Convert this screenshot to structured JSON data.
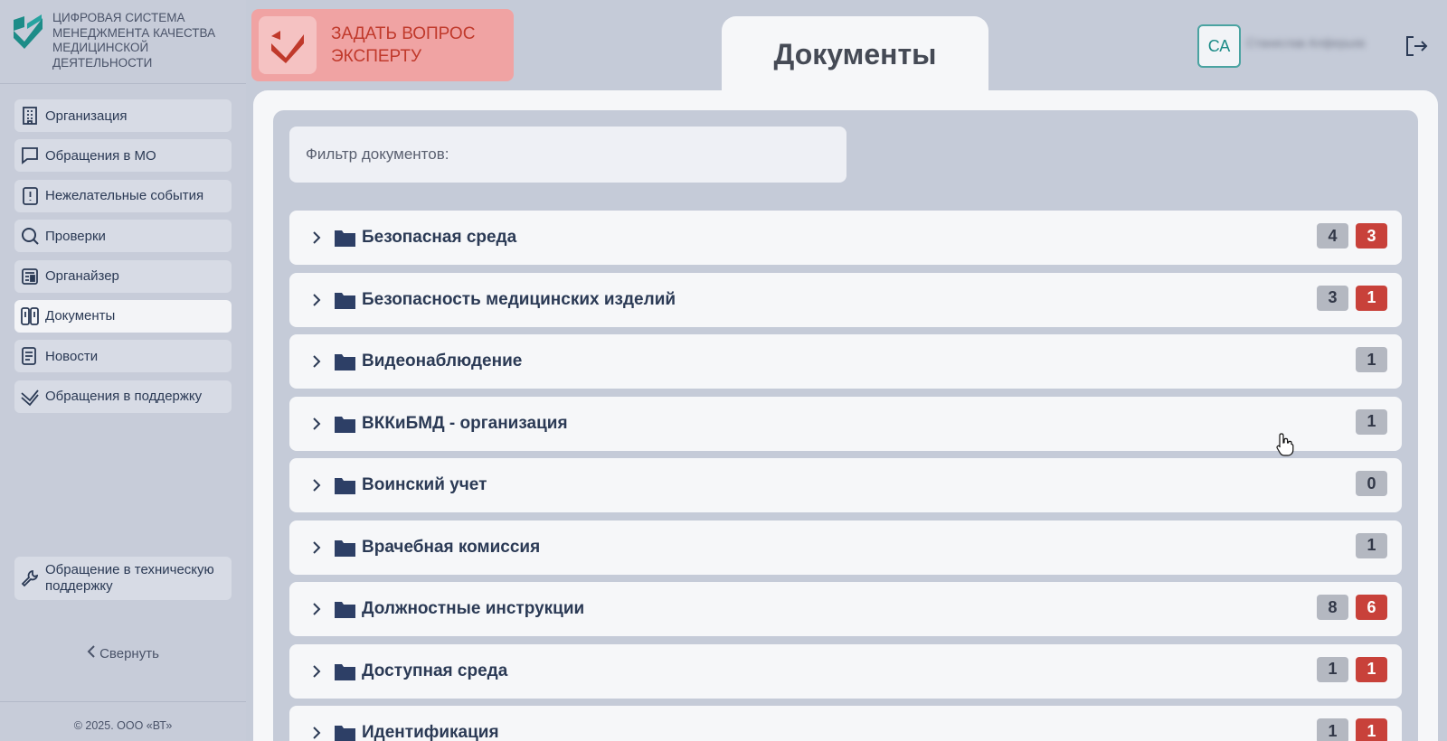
{
  "brand": {
    "lines": [
      "Цифровая система",
      "менеджмента качества",
      "медицинской",
      "деятельности"
    ]
  },
  "ask_expert": {
    "line1": "Задать вопрос",
    "line2": "эксперту"
  },
  "nav": [
    {
      "label": "Организация",
      "icon": "building-icon"
    },
    {
      "label": "Обращения в МО",
      "icon": "chat-icon"
    },
    {
      "label": "Нежелательные события",
      "icon": "alert-book-icon"
    },
    {
      "label": "Проверки",
      "icon": "search-icon"
    },
    {
      "label": "Органайзер",
      "icon": "organizer-icon"
    },
    {
      "label": "Документы",
      "icon": "documents-icon",
      "active": true
    },
    {
      "label": "Новости",
      "icon": "news-icon"
    },
    {
      "label": "Обращения в поддержку",
      "icon": "support-check-icon"
    }
  ],
  "tech_support": {
    "line1": "Обращение в техническую",
    "line2": "поддержку"
  },
  "collapse_label": "Свернуть",
  "copyright": "© 2025. ООО «ВТ»",
  "page_title": "Документы",
  "user": {
    "initials": "СА",
    "name": "Станислав Алферьев"
  },
  "filter": {
    "placeholder": "Фильтр документов:"
  },
  "folders": [
    {
      "name": "Безопасная среда",
      "count": "4",
      "alert": "3"
    },
    {
      "name": "Безопасность медицинских изделий",
      "count": "3",
      "alert": "1"
    },
    {
      "name": "Видеонаблюдение",
      "count": "1",
      "alert": ""
    },
    {
      "name": "ВККиБМД - организация",
      "count": "1",
      "alert": ""
    },
    {
      "name": "Воинский учет",
      "count": "0",
      "alert": ""
    },
    {
      "name": "Врачебная комиссия",
      "count": "1",
      "alert": ""
    },
    {
      "name": "Должностные инструкции",
      "count": "8",
      "alert": "6"
    },
    {
      "name": "Доступная среда",
      "count": "1",
      "alert": "1"
    },
    {
      "name": "Идентификация",
      "count": "1",
      "alert": "1"
    }
  ],
  "colors": {
    "accent": "#1d8c88",
    "alert": "#c8413a",
    "ask_bg": "#f0a3a3",
    "text": "#2b3a55"
  }
}
